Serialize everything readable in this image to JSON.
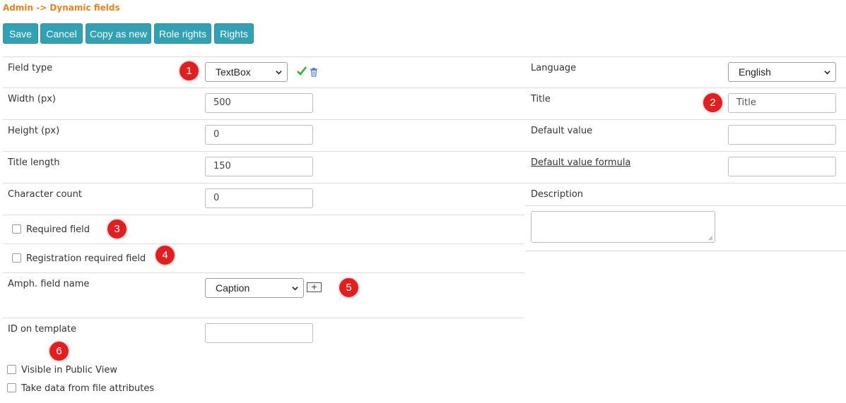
{
  "breadcrumb": "Admin -> Dynamic fields",
  "toolbar": {
    "save": "Save",
    "cancel": "Cancel",
    "copy_as_new": "Copy as new",
    "role_rights": "Role rights",
    "rights": "Rights"
  },
  "left": {
    "field_type": {
      "label": "Field type",
      "value": "TextBox"
    },
    "width": {
      "label": "Width (px)",
      "value": "500"
    },
    "height": {
      "label": "Height (px)",
      "value": "0"
    },
    "title_length": {
      "label": "Title length",
      "value": "150"
    },
    "character_count": {
      "label": "Character count",
      "value": "0"
    },
    "required_field": {
      "label": "Required field",
      "checked": false
    },
    "registration_required_field": {
      "label": "Registration required field",
      "checked": false
    },
    "amph_field_name": {
      "label": "Amph. field name",
      "value": "Caption",
      "add_label": "+"
    },
    "id_on_template": {
      "label": "ID on template",
      "value": ""
    },
    "visible_in_public_view": {
      "label": "Visible in Public View",
      "checked": false
    },
    "take_data_from_file_attributes": {
      "label": "Take data from file attributes",
      "checked": false
    }
  },
  "right": {
    "language": {
      "label": "Language",
      "value": "English"
    },
    "title": {
      "label": "Title",
      "placeholder": "Title",
      "value": ""
    },
    "default_value": {
      "label": "Default value",
      "value": ""
    },
    "default_value_formula": {
      "label": "Default value formula",
      "value": ""
    },
    "description": {
      "label": "Description",
      "value": ""
    }
  },
  "markers": [
    "1",
    "2",
    "3",
    "4",
    "5",
    "6"
  ],
  "icons": {
    "checkmark": "check-icon",
    "delete": "trash-icon",
    "dropdown": "chevron-down-icon"
  },
  "colors": {
    "accent": "#31a1b3",
    "breadcrumb": "#e8821e",
    "marker": "#e02020",
    "check": "#2fb52f",
    "trash": "#5b7fd0"
  }
}
